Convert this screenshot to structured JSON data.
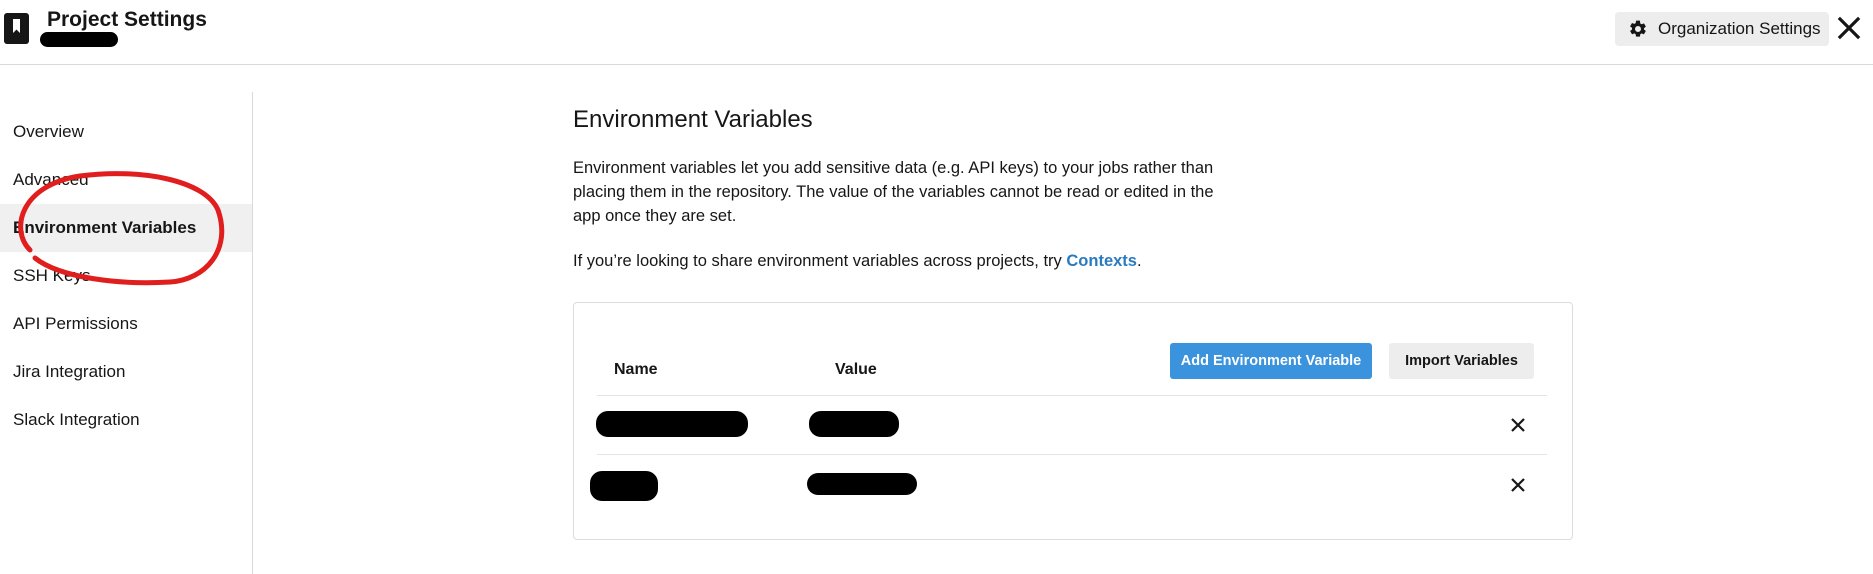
{
  "header": {
    "title": "Project Settings",
    "org_settings_label": "Organization Settings"
  },
  "sidebar": {
    "items": [
      {
        "label": "Overview"
      },
      {
        "label": "Advanced"
      },
      {
        "label": "Environment Variables",
        "active": true
      },
      {
        "label": "SSH Keys"
      },
      {
        "label": "API Permissions"
      },
      {
        "label": "Jira Integration"
      },
      {
        "label": "Slack Integration"
      }
    ]
  },
  "main": {
    "title": "Environment Variables",
    "description": "Environment variables let you add sensitive data (e.g. API keys) to your jobs rather than placing them in the repository. The value of the variables cannot be read or edited in the app once they are set.",
    "hint_prefix": "If you’re looking to share environment variables across projects, try ",
    "hint_link": "Contexts",
    "hint_suffix": "."
  },
  "table": {
    "col_name": "Name",
    "col_value": "Value",
    "add_label": "Add Environment Variable",
    "import_label": "Import Variables"
  },
  "colors": {
    "accent": "#3b93dd",
    "link": "#2a7abf",
    "annotation": "#e01e1e"
  },
  "icons": [
    "bookmark-icon",
    "gear-icon",
    "close-icon",
    "delete-x-icon"
  ]
}
